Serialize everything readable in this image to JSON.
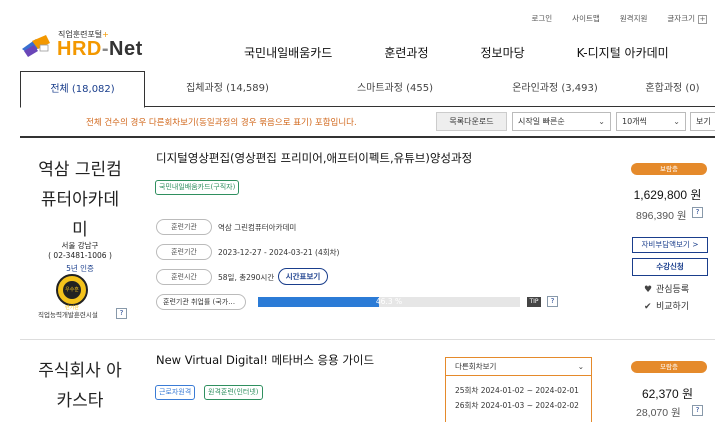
{
  "util": {
    "login": "로그인",
    "sitemap": "사이트맵",
    "accessibility": "원격지원",
    "font_size": "글자크기",
    "font_plus": "+"
  },
  "logo": {
    "sub": "직업훈련포털",
    "sub_star": "+",
    "main_hrd": "HRD",
    "main_dash": "-",
    "main_net": "Net"
  },
  "gnb": [
    "국민내일배움카드",
    "훈련과정",
    "정보마당",
    "K-디지털 아카데미"
  ],
  "tabs": [
    {
      "label": "전체 (18,082)",
      "active": true
    },
    {
      "label": "집체과정 (14,589)",
      "active": false
    },
    {
      "label": "스마트과정 (455)",
      "active": false
    },
    {
      "label": "온라인과정 (3,493)",
      "active": false
    },
    {
      "label": "혼합과정 (0)",
      "active": false
    }
  ],
  "notice": "전체 건수의 경우 다른회차보기(동일과정의 경우 묶음으로 표기) 포함입니다.",
  "controls": {
    "download": "목록다운로드",
    "sort": "시작일 빠른순",
    "per_page": "10개씩",
    "view": "보기"
  },
  "courses": [
    {
      "institution": "역삼 그린컴퓨터아카데미",
      "inst_lines": [
        "역삼 그린컴",
        "퓨터아카데",
        "미"
      ],
      "address": "서울 강남구",
      "phone": "( 02-3481-1006 )",
      "cert": "5년 인증",
      "medal_text": "우수훈련기관",
      "note": "직업능력개발훈련시설",
      "title": "디지털영상편집(영상편집 프리미어,애프터이펙트,유튜브)양성과정",
      "tags": [
        "국민내일배움카드(구직자)"
      ],
      "rows": [
        {
          "label": "훈련기관",
          "value": "역삼 그린컴퓨터아카데미"
        },
        {
          "label": "훈련기간",
          "value": "2023-12-27 - 2024-03-21 (4회차)"
        },
        {
          "label": "훈련시간",
          "value": "58일, 총290시간"
        }
      ],
      "timetable_btn": "시간표보기",
      "rate_label": "훈련기관 취업률 (국가…",
      "rate_value": 46.3,
      "rate_text": "46.3 %",
      "tip": "TIP",
      "category": "보람충",
      "price": "1,629,800 원",
      "price_sub": "896,390 원",
      "btn_self": "자비부담액보기 >",
      "btn_apply": "수강신청",
      "btn_fav": "관심등록",
      "btn_cmp": "비교하기"
    },
    {
      "inst_lines": [
        "주식회사 아",
        "카스타"
      ],
      "title": "New Virtual Digital! 메타버스 응용 가이드",
      "tags": [
        "근로자원격",
        "원격훈련(인터넷)"
      ],
      "dropdown": {
        "label": "다른회차보기",
        "items": [
          "25회차 2024-01-02 ~ 2024-02-01",
          "26회차 2024-01-03 ~ 2024-02-02"
        ]
      },
      "category": "모람충",
      "price": "62,370 원",
      "price_sub": "28,070 원"
    }
  ],
  "question_mark": "?",
  "colors": {
    "accent_orange": "#e58a2b",
    "brand_blue": "#1a3e8c",
    "progress_blue": "#2b7bd6",
    "tag_green": "#2f8f5f"
  }
}
